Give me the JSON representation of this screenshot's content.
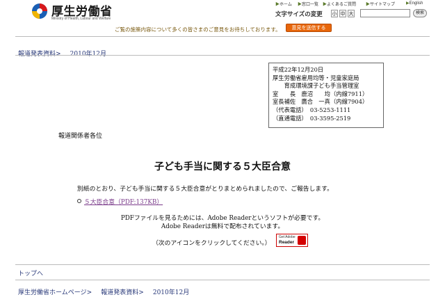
{
  "header": {
    "logo_title": "厚生労働省",
    "logo_subtitle": "Ministry of Health, Labour and Welfare",
    "top_nav": [
      {
        "label": "ホーム"
      },
      {
        "label": "窓口一覧"
      },
      {
        "label": "よくあるご質問"
      },
      {
        "label": "サイトマップ"
      },
      {
        "label": "English"
      }
    ],
    "font_size_label": "文字サイズの変更",
    "font_sizes": [
      "小",
      "中",
      "大"
    ],
    "search_placeholder": "",
    "search_button": "検索",
    "notice": "ご覧の施策内容について多くの皆さまのご意見をお待ちしております。",
    "opinion_button": "意見を送信する"
  },
  "breadcrumb_top": {
    "items": [
      "報道発表資料",
      "2010年12月"
    ],
    "separator": ">"
  },
  "contact": {
    "lines": [
      "平成22年12月20日",
      "厚生労働省雇用均等・児童家庭局",
      "　　育成環境課子ども手当管理室",
      "室　　長　鹿沼　　均（内線7911）",
      "室長補佐　鷹合　一真（内線7904）",
      "（代表電話）　03-5253-1111",
      "（直通電話）　03-3595-2519"
    ]
  },
  "body": {
    "addressee": "報道関係者各位",
    "title": "子ども手当に関する５大臣合意",
    "intro": "別紙のとおり、子ども手当に関する５大臣合意がとりまとめられましたので、ご報告します。",
    "pdf_link": "５大臣合意（PDF:137KB）",
    "pdf_note_1": "PDFファイルを見るためには、Adobe Readerというソフトが必要です。",
    "pdf_note_2": "Adobe Readerは無料で配布されています。",
    "click_note": "（次のアイコンをクリックしてください。）",
    "adobe_get": "Get Adobe",
    "adobe_reader": "Reader"
  },
  "footer": {
    "to_top": "トップへ",
    "breadcrumb": [
      "厚生労働省ホームページ",
      "報道発表資料",
      "2010年12月"
    ],
    "separator": ">"
  },
  "colors": {
    "link": "#2a3a7a",
    "visited_link": "#7a3a8a",
    "accent_button": "#e8660a"
  }
}
